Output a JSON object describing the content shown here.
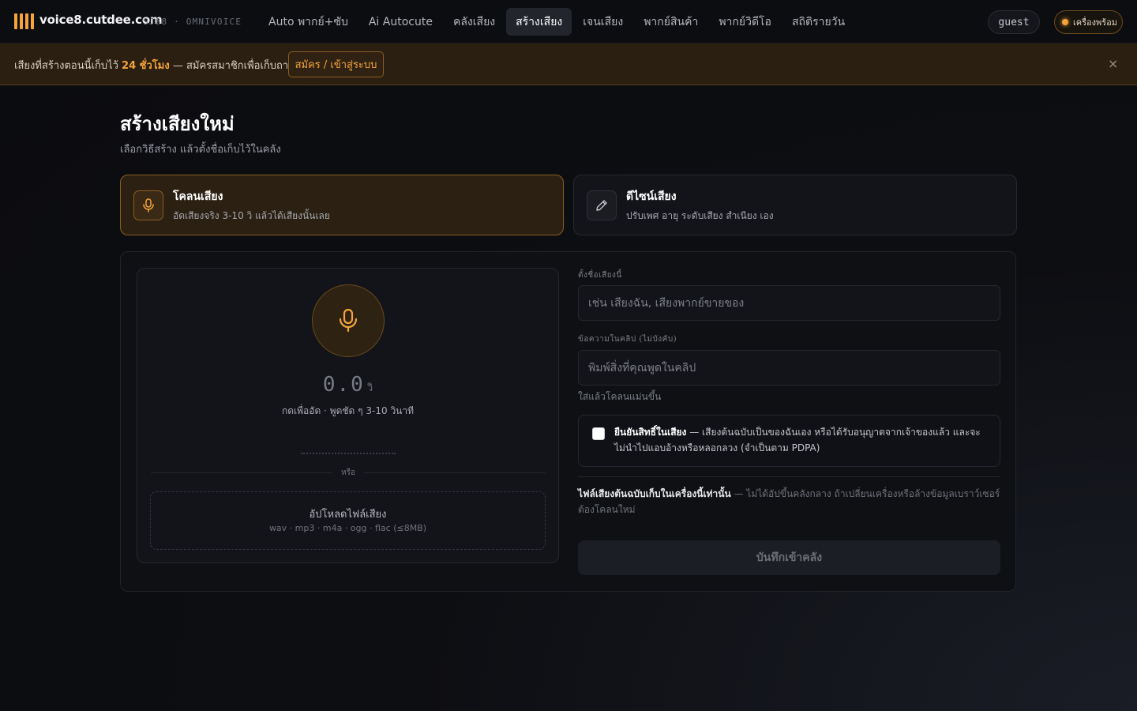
{
  "header": {
    "brand": "voice8.cutdee.com",
    "brand_sub": "SJ88 · OMNIVOICE",
    "nav": [
      {
        "label": "Auto พากย์+ซับ"
      },
      {
        "label": "Ai Autocute"
      },
      {
        "label": "คลังเสียง"
      },
      {
        "label": "สร้างเสียง",
        "active": true
      },
      {
        "label": "เจนเสียง"
      },
      {
        "label": "พากย์สินค้า"
      },
      {
        "label": "พากย์วิดีโอ"
      },
      {
        "label": "สถิติรายวัน"
      }
    ],
    "user": "guest",
    "status": "เครื่องพร้อม",
    "accent": "#f5a43c"
  },
  "banner": {
    "text_before": "เสียงที่สร้างตอนนี้เก็บไว้ ",
    "highlight": "24 ชั่วโมง",
    "text_after": " — สมัครสมาชิกเพื่อเก็บถาวร",
    "button": "สมัคร / เข้าสู่ระบบ",
    "close": "×"
  },
  "page": {
    "title": "สร้างเสียงใหม่",
    "subtitle": "เลือกวิธีสร้าง แล้วตั้งชื่อเก็บไว้ในคลัง"
  },
  "modes": [
    {
      "title": "โคลนเสียง",
      "desc": "อัดเสียงจริง 3-10 วิ แล้วได้เสียงนั้นเลย",
      "icon": "mic-icon",
      "selected": true
    },
    {
      "title": "ดีไซน์เสียง",
      "desc": "ปรับเพศ อายุ ระดับเสียง สำเนียง เอง",
      "icon": "pencil-icon",
      "selected": false
    }
  ],
  "recorder": {
    "timer": "0.0",
    "unit": "วิ",
    "hint": "กดเพื่ออัด · พูดชัด ๆ 3-10 วินาที",
    "or": "หรือ",
    "upload_title": "อัปโหลดไฟล์เสียง",
    "upload_types": "wav · mp3 · m4a · ogg · flac (≤8MB)"
  },
  "form": {
    "name_label": "ตั้งชื่อเสียงนี้",
    "name_placeholder": "เช่น เสียงฉัน, เสียงพากย์ขายของ",
    "text_label": "ข้อความในคลิป (ไม่บังคับ)",
    "text_placeholder": "พิมพ์สิ่งที่คุณพูดในคลิป",
    "text_hint": "ใส่แล้วโคลนแม่นขึ้น",
    "consent_bold": "ยืนยันสิทธิ์ในเสียง",
    "consent_text": " — เสียงต้นฉบับเป็นของฉันเอง หรือได้รับอนุญาตจากเจ้าของแล้ว และจะไม่นำไปแอบอ้างหรือหลอกลวง (จำเป็นตาม PDPA)",
    "consent_checked": false,
    "note_bold": "ไฟล์เสียงต้นฉบับเก็บในเครื่องนี้เท่านั้น",
    "note_text": " — ไม่ได้อัปขึ้นคลังกลาง ถ้าเปลี่ยนเครื่องหรือล้างข้อมูลเบราว์เซอร์ ต้องโคลนใหม่",
    "save": "บันทึกเข้าคลัง"
  }
}
